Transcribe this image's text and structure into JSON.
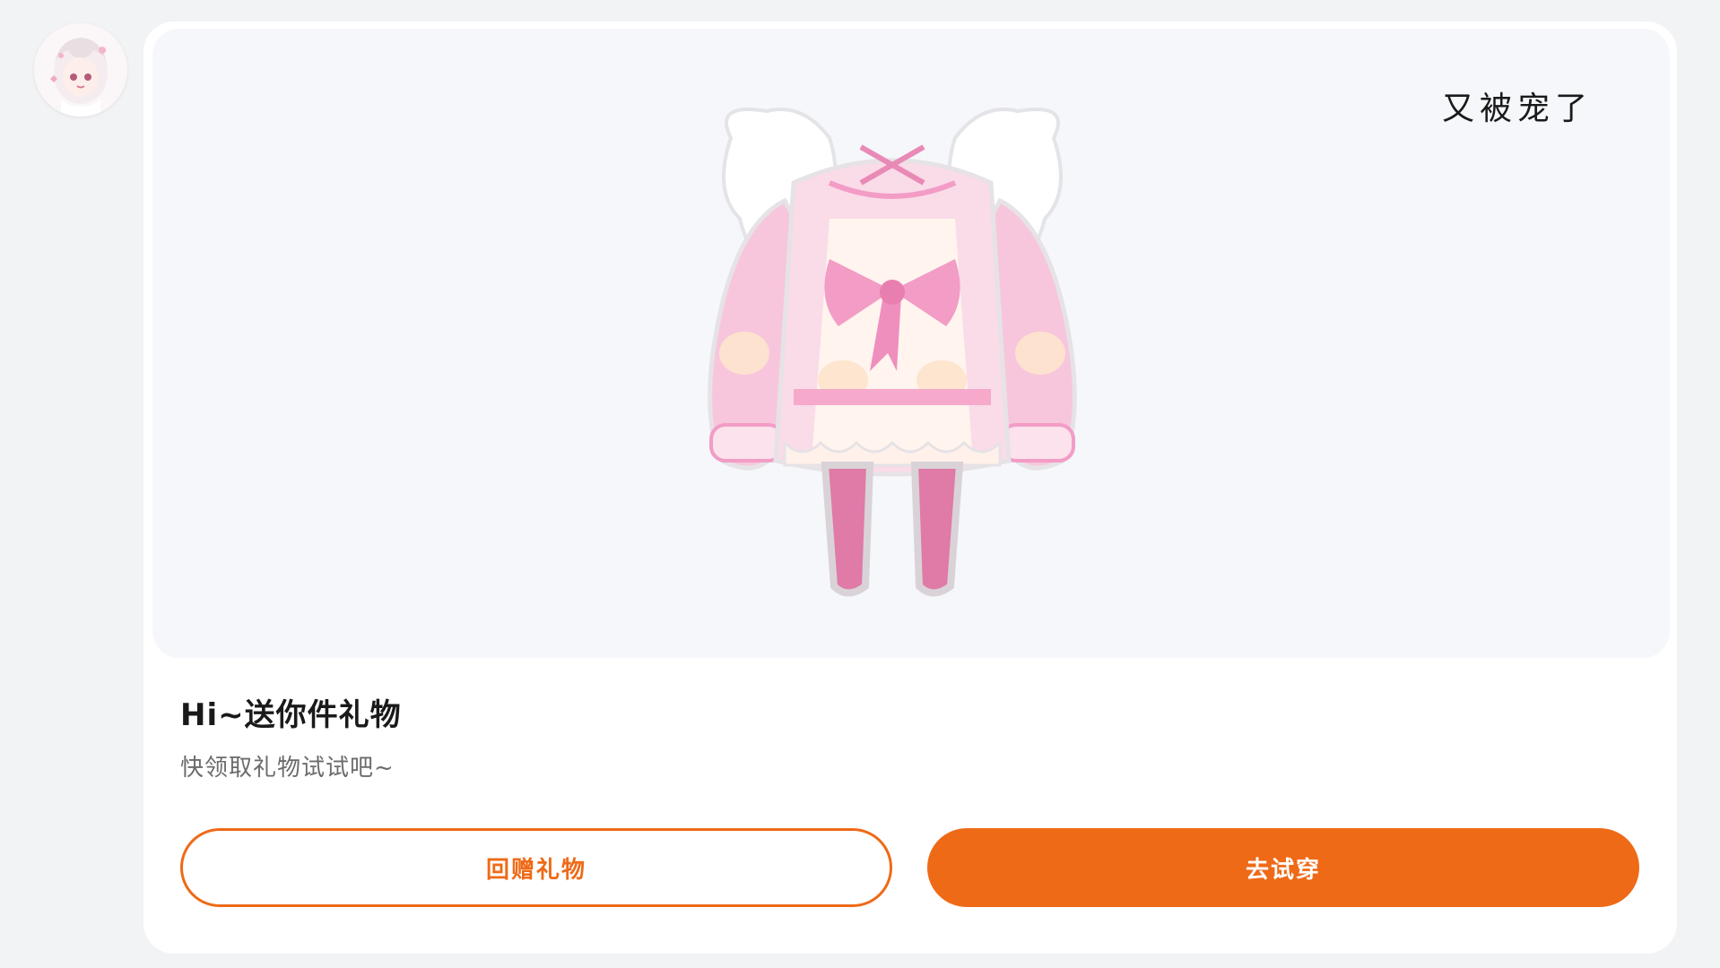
{
  "user": {
    "avatar_icon": "anime-girl-avatar-icon"
  },
  "gift": {
    "tag": "又被宠了",
    "title": "Hi~送你件礼物",
    "subtitle": "快领取礼物试试吧~",
    "image_icon": "pink-outfit-icon"
  },
  "actions": {
    "return_gift_label": "回赠礼物",
    "try_on_label": "去试穿"
  },
  "colors": {
    "accent": "#ee6a17",
    "outfit_pink": "#f7c6dc",
    "outfit_bow": "#f29cc6",
    "stockings": "#e07aa7"
  }
}
